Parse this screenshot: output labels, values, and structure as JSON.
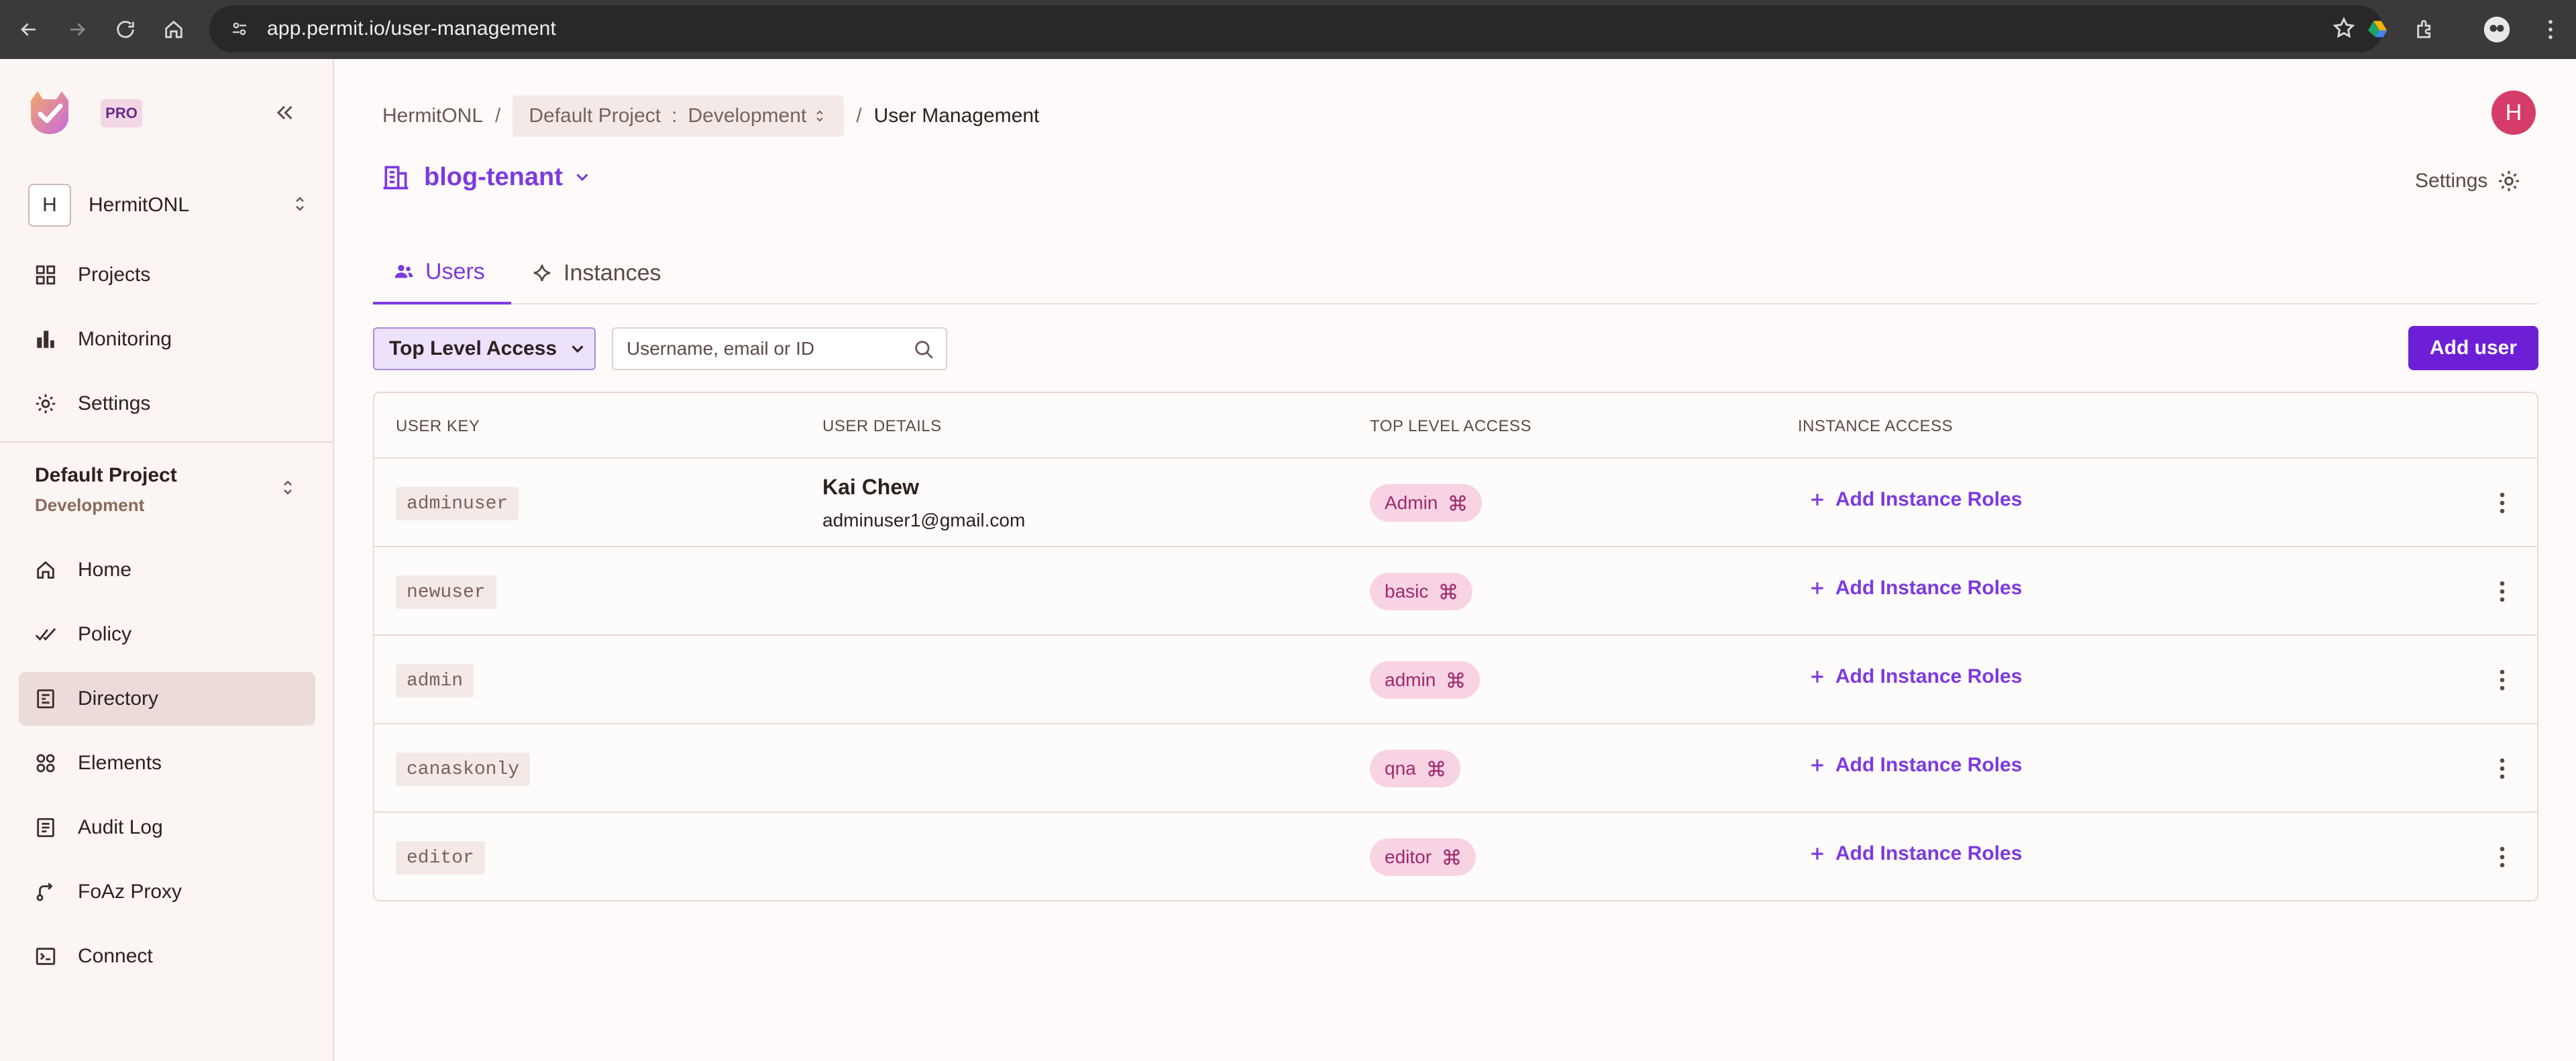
{
  "browser": {
    "url": "app.permit.io/user-management"
  },
  "sidebar": {
    "pro_badge": "PRO",
    "org": {
      "initial": "H",
      "name": "HermitONL"
    },
    "top_items": [
      {
        "label": "Projects",
        "icon": "grid-icon"
      },
      {
        "label": "Monitoring",
        "icon": "bar-chart-icon"
      },
      {
        "label": "Settings",
        "icon": "gear-icon"
      }
    ],
    "project": {
      "name": "Default Project",
      "env": "Development"
    },
    "items": [
      {
        "label": "Home",
        "icon": "home-icon"
      },
      {
        "label": "Policy",
        "icon": "policy-check-icon"
      },
      {
        "label": "Directory",
        "icon": "directory-icon",
        "active": true
      },
      {
        "label": "Elements",
        "icon": "elements-icon"
      },
      {
        "label": "Audit Log",
        "icon": "audit-log-icon"
      },
      {
        "label": "FoAz Proxy",
        "icon": "proxy-icon"
      },
      {
        "label": "Connect",
        "icon": "terminal-icon"
      }
    ]
  },
  "header": {
    "breadcrumb": {
      "org": "HermitONL",
      "sep1": "/",
      "project": "Default Project",
      "colon": ":",
      "env": "Development",
      "sep2": "/",
      "current": "User Management"
    },
    "avatar_initial": "H",
    "tenant": "blog-tenant",
    "settings_label": "Settings"
  },
  "tabs": [
    {
      "label": "Users",
      "active": true
    },
    {
      "label": "Instances",
      "active": false
    }
  ],
  "toolbar": {
    "filter_label": "Top Level Access",
    "search_placeholder": "Username, email or ID",
    "add_user_label": "Add user"
  },
  "table": {
    "columns": [
      "USER KEY",
      "USER DETAILS",
      "TOP LEVEL ACCESS",
      "INSTANCE ACCESS"
    ],
    "rows": [
      {
        "key": "adminuser",
        "name": "Kai Chew",
        "email": "adminuser1@gmail.com",
        "role": "Admin",
        "action": "Add Instance Roles"
      },
      {
        "key": "newuser",
        "name": "",
        "email": "",
        "role": "basic",
        "action": "Add Instance Roles"
      },
      {
        "key": "admin",
        "name": "",
        "email": "",
        "role": "admin",
        "action": "Add Instance Roles"
      },
      {
        "key": "canaskonly",
        "name": "",
        "email": "",
        "role": "qna",
        "action": "Add Instance Roles"
      },
      {
        "key": "editor",
        "name": "",
        "email": "",
        "role": "editor",
        "action": "Add Instance Roles"
      }
    ]
  },
  "colors": {
    "accent": "#7c3adf",
    "primary_button": "#6d1fd6",
    "role_chip_bg": "#f8d3e4",
    "avatar": "#d63c6a"
  }
}
